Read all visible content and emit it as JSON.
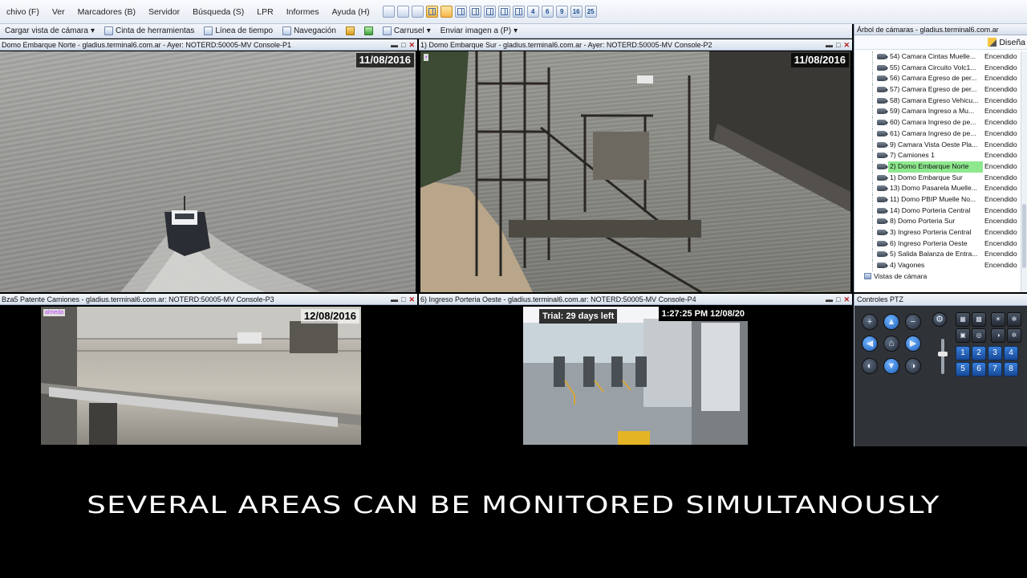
{
  "menubar": {
    "items": [
      "chivo (F)",
      "Ver",
      "Marcadores (B)",
      "Servidor",
      "Búsqueda (S)",
      "LPR",
      "Informes",
      "Ayuda (H)"
    ],
    "layout_numbers": [
      "4",
      "6",
      "9",
      "16",
      "25"
    ]
  },
  "toolbar2": {
    "load_view": "Cargar vista de cámara",
    "toolbar_tape": "Cinta de herramientas",
    "timeline": "Línea de tiempo",
    "navigation": "Navegación",
    "carousel": "Carrusel",
    "send_image": "Enviar imagen a (P)"
  },
  "panels": [
    {
      "title": "Domo Embarque Norte - gladius.terminal6.com.ar - Ayer: NOTERD:50005-MV Console-P1",
      "date": "11/08/2016"
    },
    {
      "title": "1) Domo Embarque Sur - gladius.terminal6.com.ar - Ayer: NOTERD:50005-MV Console-P2",
      "date": "11/08/2016"
    },
    {
      "title": "Bza5 Patente Camiones - gladius.terminal6.com.ar: NOTERD:50005-MV Console-P3",
      "date": "12/08/2016",
      "tag": "almeda"
    },
    {
      "title": "6) Ingreso Porteria Oeste - gladius.terminal6.com.ar: NOTERD:50005-MV Console-P4",
      "trial": "Trial: 29 days left",
      "time": "1:27:25 PM 12/08/20"
    }
  ],
  "tree": {
    "title": "Árbol de cámaras - gladius.terminal6.com.ar",
    "design_label": "Diseña",
    "rows": [
      {
        "name": "54) Camara Cintas Muelle...",
        "state": "Encendido"
      },
      {
        "name": "55) Camara Circuito Volc1...",
        "state": "Encendido"
      },
      {
        "name": "56) Camara Egreso de per...",
        "state": "Encendido"
      },
      {
        "name": "57) Camara Egreso de per...",
        "state": "Encendido"
      },
      {
        "name": "58) Camara Egreso Vehicu...",
        "state": "Encendido"
      },
      {
        "name": "59) Camara Ingreso a Mu...",
        "state": "Encendido"
      },
      {
        "name": "60) Camara Ingreso de pe...",
        "state": "Encendido"
      },
      {
        "name": "61) Camara Ingreso de pe...",
        "state": "Encendido"
      },
      {
        "name": "9) Camara Vista Oeste Pla...",
        "state": "Encendido"
      },
      {
        "name": "7) Camiones 1",
        "state": "Encendido"
      },
      {
        "name": "2) Domo Embarque Norte",
        "state": "Encendido",
        "highlight": true
      },
      {
        "name": "1) Domo Embarque Sur",
        "state": "Encendido"
      },
      {
        "name": "13) Domo Pasarela Muelle...",
        "state": "Encendido"
      },
      {
        "name": "11) Domo PBIP Muelle No...",
        "state": "Encendido"
      },
      {
        "name": "14) Domo Porteria Central",
        "state": "Encendido"
      },
      {
        "name": "8) Domo Porteria Sur",
        "state": "Encendido"
      },
      {
        "name": "3) Ingreso Porteria Central",
        "state": "Encendido"
      },
      {
        "name": "6) Ingreso Porteria Oeste",
        "state": "Encendido"
      },
      {
        "name": "5) Salida Balanza de Entra...",
        "state": "Encendido"
      },
      {
        "name": "4) Vagones",
        "state": "Encendido"
      }
    ],
    "root_label": "Vistas de cámara"
  },
  "ptz": {
    "title": "Controles PTZ",
    "numbers": [
      "1",
      "2",
      "3",
      "4",
      "5",
      "6",
      "7",
      "8"
    ]
  },
  "caption": "SEVERAL AREAS CAN BE MONITORED SIMULTANOUSLY"
}
